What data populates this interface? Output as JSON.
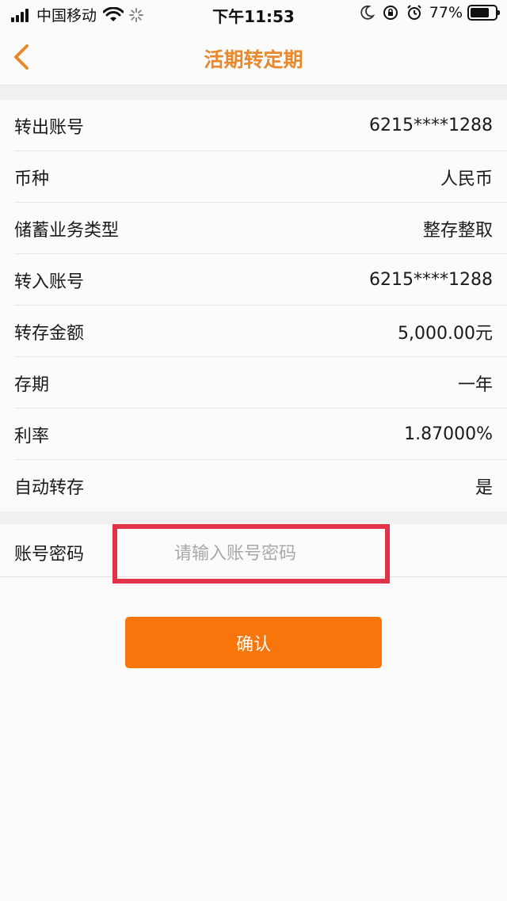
{
  "status_bar": {
    "carrier": "中国移动",
    "time": "下午11:53",
    "battery": "77%",
    "battery_level": 0.77,
    "icons": [
      "signal-icon",
      "wifi-icon",
      "loading-icon",
      "moon-icon",
      "rotation-lock-icon",
      "alarm-icon",
      "battery-icon"
    ]
  },
  "nav": {
    "title": "活期转定期",
    "back_icon": "chevron-left-icon"
  },
  "colors": {
    "accent": "#e8892d",
    "button": "#f7750b",
    "highlight_box": "#e2334a"
  },
  "details": [
    {
      "label": "转出账号",
      "value": "6215****1288"
    },
    {
      "label": "币种",
      "value": "人民币"
    },
    {
      "label": "储蓄业务类型",
      "value": "整存整取"
    },
    {
      "label": "转入账号",
      "value": "6215****1288"
    },
    {
      "label": "转存金额",
      "value": "5,000.00元"
    },
    {
      "label": "存期",
      "value": "一年"
    },
    {
      "label": "利率",
      "value": "1.87000%"
    },
    {
      "label": "自动转存",
      "value": "是"
    }
  ],
  "password": {
    "label": "账号密码",
    "placeholder": "请输入账号密码",
    "value": ""
  },
  "confirm_label": "确认"
}
